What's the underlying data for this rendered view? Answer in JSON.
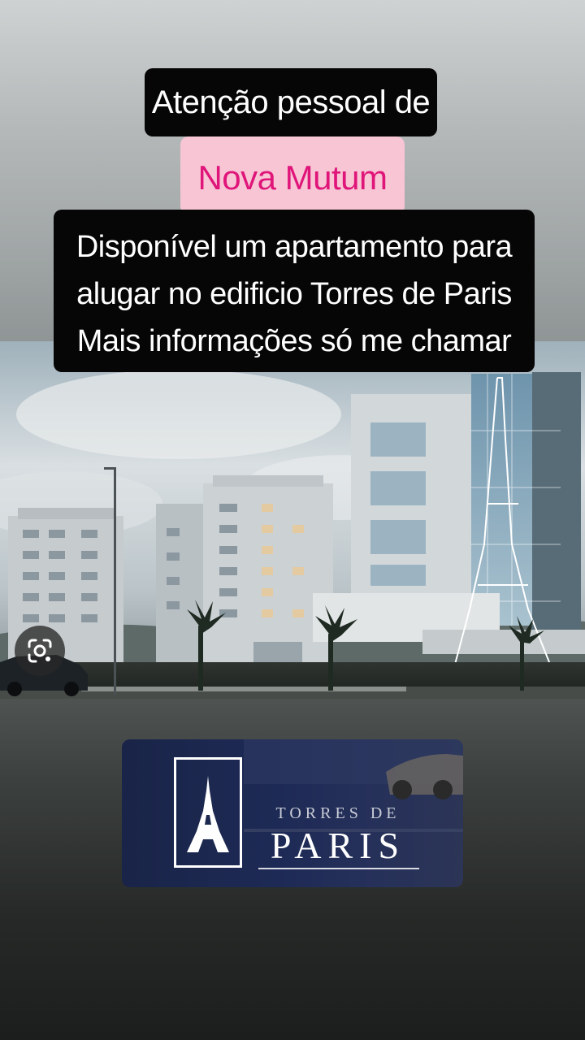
{
  "story": {
    "line1": "Atenção pessoal de",
    "line2": "Nova Mutum",
    "para": [
      "Disponível um apartamento para",
      "alugar no edificio Torres de Paris",
      "Mais informações só me chamar"
    ]
  },
  "logo": {
    "top": "TORRES DE",
    "bottom": "PARIS"
  },
  "colors": {
    "pink_bg": "#f7c5d4",
    "pink_text": "#e0157a",
    "black_bg": "#060606",
    "logo_bg": "#1d2a55"
  },
  "icons": {
    "lens": "lens-search-icon",
    "eiffel": "eiffel-tower-icon"
  }
}
